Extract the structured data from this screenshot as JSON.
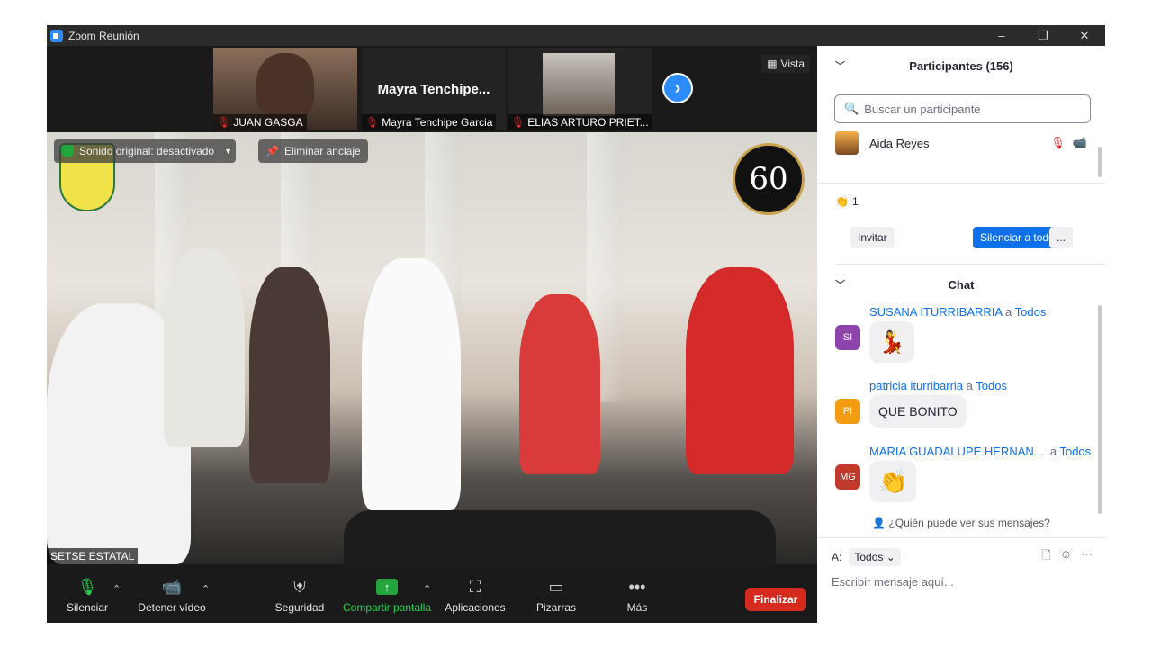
{
  "window": {
    "title": "Zoom Reunión",
    "controls": [
      "–",
      "❐",
      "✕"
    ]
  },
  "gallery": {
    "participants": [
      {
        "name": "JUAN GASGA",
        "has_video": true
      },
      {
        "name": "Mayra Tenchipe Garcia",
        "display_name": "Mayra  Tenchipe...",
        "has_video": false
      },
      {
        "name": "ELIAS ARTURO PRIET...",
        "has_video": true
      }
    ],
    "view_label": "Vista",
    "next_icon": "chevron-right-icon"
  },
  "main_video": {
    "original_sound": "Sonido original: desactivado",
    "unpin": "Eliminar anclaje",
    "label": "SETSE ESTATAL",
    "badge": "60"
  },
  "toolbar": {
    "mute": "Silenciar",
    "stop_video": "Detener vídeo",
    "security": "Seguridad",
    "share": "Compartir pantalla",
    "apps": "Aplicaciones",
    "whiteboards": "Pizarras",
    "more": "Más",
    "end": "Finalizar"
  },
  "participants_panel": {
    "title": "Participantes (156)",
    "search_placeholder": "Buscar un participante",
    "participant_name": "Aida Reyes",
    "reaction_count": "1",
    "invite": "Invitar",
    "mute_all": "Silenciar a todos",
    "more": "..."
  },
  "chat": {
    "title": "Chat",
    "messages": [
      {
        "sender": "SUSANA ITURRIBARRIA",
        "to_word": "a",
        "to": "Todos",
        "initials": "SI",
        "avatar_color": "#8e44ad",
        "content": "💃"
      },
      {
        "sender": "patricia iturribarria",
        "to_word": "a",
        "to": "Todos",
        "initials": "PI",
        "avatar_color": "#f39c12",
        "content": "QUE BONITO"
      },
      {
        "sender": "MARIA GUADALUPE HERNAN...",
        "to_word": "a",
        "to": "Todos",
        "initials": "MG",
        "avatar_color": "#c0392b",
        "content": "👏"
      }
    ],
    "who_can_see": "¿Quién puede ver sus mensajes?",
    "to_label": "A:",
    "to_value": "Todos",
    "compose_placeholder": "Escribir mensaje aquí..."
  }
}
